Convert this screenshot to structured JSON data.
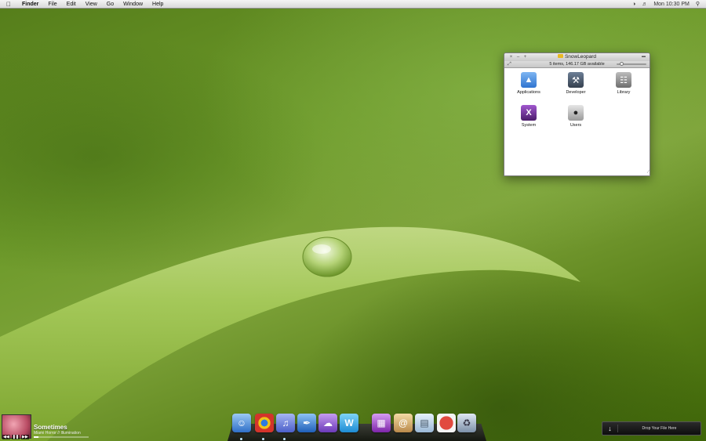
{
  "menubar": {
    "apple_icon": "apple-icon",
    "app_name": "Finder",
    "menus": [
      "File",
      "Edit",
      "View",
      "Go",
      "Window",
      "Help"
    ],
    "clock": "Mon 10:30 PM",
    "status_icons": [
      "time-machine-icon",
      "volume-icon",
      "spotlight-icon"
    ]
  },
  "finder": {
    "title": "SnowLeopard",
    "status": "5 items, 146.17 GB available",
    "items": [
      {
        "label": "Applications",
        "icon": "app-store-icon",
        "color": "#3d87e0"
      },
      {
        "label": "Developer",
        "icon": "hammer-icon",
        "color": "#4b5b6e"
      },
      {
        "label": "Library",
        "icon": "library-columns-icon",
        "color": "#8c8c8c"
      },
      {
        "label": "System",
        "icon": "x-system-icon",
        "color": "#6b2e8e"
      },
      {
        "label": "Users",
        "icon": "users-icon",
        "color": "#8d8d8d"
      }
    ]
  },
  "now_playing": {
    "song": "Sometimes",
    "artist": "Miami Horror // Illumination",
    "progress": 0.08
  },
  "dock": {
    "items": [
      {
        "name": "finder",
        "color": "#4a8fe0"
      },
      {
        "name": "chrome",
        "color": "#d9d9d9"
      },
      {
        "name": "itunes",
        "color": "#6b7fd6"
      },
      {
        "name": "pen-app",
        "color": "#2c6fc2"
      },
      {
        "name": "chat",
        "color": "#8a58c9"
      },
      {
        "name": "word",
        "color": "#2b9be0"
      },
      {
        "name": "stack",
        "color": "#9b3cc2"
      },
      {
        "name": "address-book",
        "color": "#d8b06a"
      },
      {
        "name": "folder",
        "color": "#b8d3e8"
      },
      {
        "name": "angry-birds",
        "color": "#c8312c"
      },
      {
        "name": "trash",
        "color": "#a9b7c9"
      }
    ]
  },
  "drop_zone": {
    "label": "Drop Your File Here"
  }
}
